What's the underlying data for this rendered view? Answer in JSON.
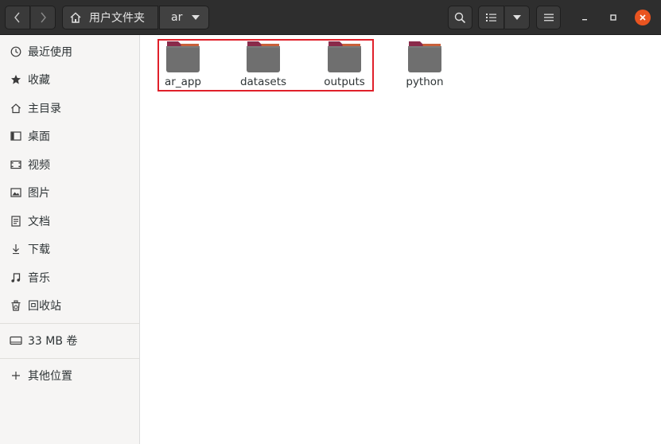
{
  "header": {
    "path": {
      "home_label": "用户文件夹",
      "current_label": "ar"
    }
  },
  "sidebar": {
    "items": [
      {
        "label": "最近使用",
        "icon": "clock-icon"
      },
      {
        "label": "收藏",
        "icon": "star-icon"
      },
      {
        "label": "主目录",
        "icon": "home-icon"
      },
      {
        "label": "桌面",
        "icon": "desktop-icon"
      },
      {
        "label": "视频",
        "icon": "video-icon"
      },
      {
        "label": "图片",
        "icon": "image-icon"
      },
      {
        "label": "文档",
        "icon": "document-icon"
      },
      {
        "label": "下载",
        "icon": "download-icon"
      },
      {
        "label": "音乐",
        "icon": "music-icon"
      },
      {
        "label": "回收站",
        "icon": "trash-icon"
      }
    ],
    "volume": {
      "label": "33 MB 卷",
      "icon": "drive-icon"
    },
    "other_locations": {
      "label": "其他位置",
      "icon": "plus-icon"
    }
  },
  "main": {
    "folders": [
      {
        "name": "ar_app"
      },
      {
        "name": "datasets"
      },
      {
        "name": "outputs"
      },
      {
        "name": "python"
      }
    ],
    "highlighted": [
      "ar_app",
      "datasets",
      "outputs"
    ]
  },
  "colors": {
    "headerbar": "#2e2e2e",
    "close_button": "#e95420",
    "highlight_box": "#e0202a",
    "folder_body": "#6f6f6f",
    "folder_tab": "#8a2a4a"
  }
}
